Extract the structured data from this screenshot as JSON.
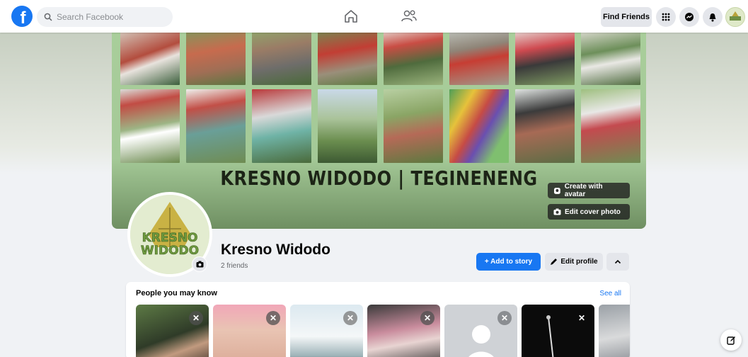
{
  "nav": {
    "search_placeholder": "Search Facebook",
    "find_friends": "Find Friends"
  },
  "cover": {
    "title": "KRESNO WIDODO | TEGINENENG",
    "create_with_avatar": "Create with avatar",
    "edit_cover_photo": "Edit cover photo"
  },
  "profile": {
    "name": "Kresno Widodo",
    "friends": "2 friends",
    "logo_line1": "KRESNO",
    "logo_line2": "WIDODO",
    "add_to_story": "+ Add to story",
    "edit_profile": "Edit profile"
  },
  "pymk": {
    "title": "People you may know",
    "see_all": "See all"
  },
  "colors": {
    "brand": "#1877f2",
    "cover_green": "#a6cb99",
    "background": "#f0f2f5"
  },
  "icons": [
    "facebook-logo-icon",
    "search-icon",
    "home-icon",
    "friends-icon",
    "menu-grid-icon",
    "messenger-icon",
    "bell-icon",
    "camera-icon",
    "pencil-icon",
    "chevron-up-icon",
    "close-icon",
    "compose-icon"
  ]
}
